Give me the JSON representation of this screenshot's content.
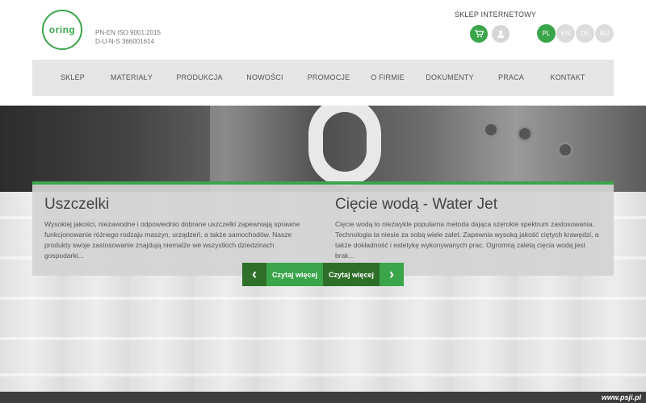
{
  "header": {
    "logo_text": "oring",
    "cert_lines": [
      "PN-EN ISO 9001:2015",
      "D-U-N-S 366001614"
    ],
    "shop_label": "SKLEP INTERNETOWY",
    "languages": [
      "PL",
      "EN",
      "DE",
      "RU"
    ]
  },
  "nav": {
    "items": [
      "SKLEP",
      "MATERIAŁY",
      "PRODUKCJA",
      "NOWOŚCI",
      "PROMOCJE",
      "O FIRMIE",
      "DOKUMENTY",
      "PRACA",
      "KONTAKT"
    ]
  },
  "panels": [
    {
      "title": "Uszczelki",
      "text": "Wysokiej jakości, niezawodne i odpowiednio dobrane uszczelki zapewniają sprawne funkcjonowanie różnego rodzaju maszyn, urządzeń, a także samochodów. Nasze produkty swoje zastosowanie znajdują niemalże we wszystkich dziedzinach gospodarki..."
    },
    {
      "title": "Cięcie wodą - Water Jet",
      "text": "Cięcie wodą to niezwykle popularna metoda dająca szerokie spektrum zastosowania. Technologia ta niesie za sobą wiele zalet. Zapewnia wysoką jakość ciętych krawędzi, a także dokładność i estetykę wykonywanych prac. Ogromną zaletą cięcia wodą jest brak..."
    }
  ],
  "buttons": {
    "read_more_1": "Czytaj więcej",
    "read_more_2": "Czytaj więcej",
    "prev_icon": "‹",
    "next_icon": "›"
  },
  "footer": {
    "watermark": "www.psji.pl"
  },
  "colors": {
    "accent": "#3aa54a",
    "accent_dark": "#2f6f2a"
  }
}
